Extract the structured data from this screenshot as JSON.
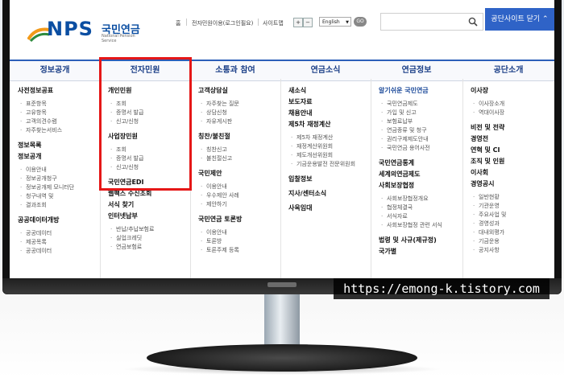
{
  "header": {
    "logo": {
      "brand": "NPS",
      "name_ko": "국민연금",
      "name_en": "National Pension Service"
    },
    "util_links": [
      "홈",
      "전자민원이용(로그인필요)",
      "사이트맵"
    ],
    "zoom_plus": "+",
    "zoom_minus": "−",
    "language_value": "English",
    "language_go": "GO",
    "search_placeholder": "",
    "corp_button": "공단사이트 닫기 ⌃"
  },
  "gnb": [
    "정보공개",
    "전자민원",
    "소통과 참여",
    "연금소식",
    "연금정보",
    "공단소개"
  ],
  "columns": {
    "c1": {
      "h1": "사전정보공표",
      "h1_items": [
        "표준항목",
        "고유항목",
        "고객의견수렴",
        "자주찾는서비스"
      ],
      "h2": "정보목록",
      "h3": "정보공개",
      "h3_items": [
        "이용안내",
        "정보공개청구",
        "정보공개제 모니터단",
        "청구내역 및",
        "결과조회"
      ],
      "h4": "공공데이터개방",
      "h4_items": [
        "공공데이터",
        "제공목록",
        "공공데이터"
      ]
    },
    "c2": {
      "h1": "개인민원",
      "h1_items": [
        "조회",
        "증명서 발급",
        "신고/신청"
      ],
      "h2": "사업장민원",
      "h2_items": [
        "조회",
        "증명서 발급",
        "신고/신청"
      ],
      "h3": "국민연금EDI",
      "h4": "웹팩스 수신조회",
      "h5": "서식 찾기",
      "h6": "인터넷납부",
      "h6_items": [
        "반납/추납보험료",
        "실업크레딧",
        "연금보험료"
      ]
    },
    "c3": {
      "h1": "고객상담실",
      "h1_items": [
        "자주찾는 질문",
        "상담신청",
        "자유게시판"
      ],
      "h2": "칭찬/불친절",
      "h2_items": [
        "칭찬신고",
        "불친절신고"
      ],
      "h3": "국민제안",
      "h3_items": [
        "이용안내",
        "우수제안 사례",
        "제안하기"
      ],
      "h4": "국민연금 토론방",
      "h4_items": [
        "이용안내",
        "토론방",
        "토론주제 등록"
      ]
    },
    "c4": {
      "h1": "새소식",
      "h2": "보도자료",
      "h3": "채용안내",
      "h4": "제5차 재정계산",
      "h4_items": [
        "제5차 재정계산",
        "재정계산위원회",
        "제도개선위원회",
        "기금운용발전 전문위원회"
      ],
      "h5": "입찰정보",
      "h6": "지사/센터소식",
      "h7": "사옥임대"
    },
    "c5": {
      "h1": "알기쉬운 국민연금",
      "h1_items": [
        "국민연금제도",
        "가입 및 신고",
        "보험료납부",
        "연금종류 및 청구",
        "권리구제제도안내",
        "국민연금 용어사전"
      ],
      "h2": "국민연금통계",
      "h3": "세계의연금제도",
      "h4": "사회보장협정",
      "h4_items": [
        "사회보장협정개요",
        "협정체결국",
        "서식자료",
        "사회보장협정 관련 서식"
      ],
      "h5": "법령 및 사규(제규정)",
      "h6": "국가별"
    },
    "c6": {
      "h1": "이사장",
      "h1_items": [
        "이사장소개",
        "역대이사장"
      ],
      "h2": "비전 및 전략",
      "h3": "경영전",
      "h4": "연혁 및 CI",
      "h5": "조직 및 인원",
      "h6": "이사회",
      "h7": "경영공시",
      "h7_items": [
        "일반현황",
        "기관운영",
        "주요사업 및",
        "경영성과",
        "대내외평가",
        "기금운용",
        "공지사항"
      ]
    }
  },
  "watermark": "https://emong-k.tistory.com",
  "colors": {
    "nav_accent": "#2c5fb9",
    "highlight": "#e51717",
    "brand_blue": "#0b4ea2"
  }
}
